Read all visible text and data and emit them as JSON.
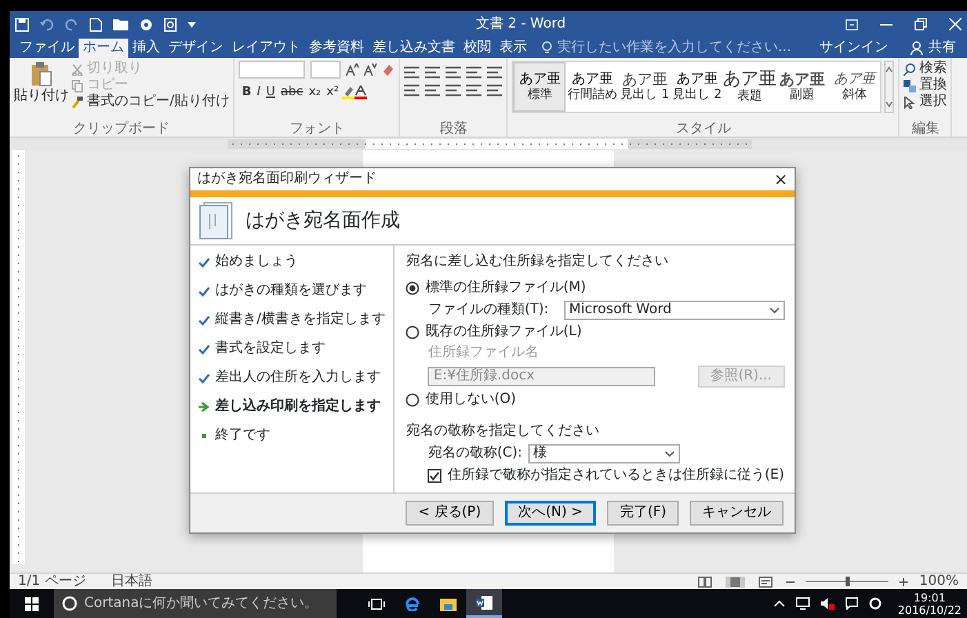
{
  "window": {
    "title": "文書 2 - Word"
  },
  "ribbon_tabs": [
    {
      "label": "ファイル",
      "selected": false
    },
    {
      "label": "ホーム",
      "selected": true
    },
    {
      "label": "挿入",
      "selected": false
    },
    {
      "label": "デザイン",
      "selected": false
    },
    {
      "label": "レイアウト",
      "selected": false
    },
    {
      "label": "参考資料",
      "selected": false
    },
    {
      "label": "差し込み文書",
      "selected": false
    },
    {
      "label": "校閲",
      "selected": false
    },
    {
      "label": "表示",
      "selected": false
    }
  ],
  "tell_me": {
    "placeholder": "実行したい作業を入力してください..."
  },
  "account": {
    "sign_in": "サインイン",
    "share": "共有"
  },
  "ribbon": {
    "clipboard": {
      "paste": "貼り付け",
      "items": [
        {
          "label": "切り取り",
          "disabled": true
        },
        {
          "label": "コピー",
          "disabled": true
        },
        {
          "label": "書式のコピー/貼り付け",
          "disabled": false
        }
      ],
      "label": "クリップボード"
    },
    "font": {
      "buttons": [
        "B",
        "I",
        "U",
        "abc",
        "x₂",
        "x²"
      ],
      "label": "フォント"
    },
    "paragraph": {
      "label": "段落"
    },
    "styles": {
      "items": [
        {
          "preview": "あア亜",
          "name": "標準",
          "kind": "normal",
          "selected": true
        },
        {
          "preview": "あア亜",
          "name": "行間詰め",
          "kind": "normal",
          "selected": false
        },
        {
          "preview": "あア亜",
          "name": "見出し 1",
          "kind": "heading",
          "selected": false
        },
        {
          "preview": "あア亜",
          "name": "見出し 2",
          "kind": "normal",
          "selected": false
        },
        {
          "preview": "あア亜",
          "name": "表題",
          "kind": "title",
          "selected": false
        },
        {
          "preview": "あア亜",
          "name": "副題",
          "kind": "subtitle",
          "selected": false
        },
        {
          "preview": "あア亜",
          "name": "斜体",
          "kind": "emphasis",
          "selected": false
        }
      ],
      "label": "スタイル"
    },
    "editing": {
      "find": "検索",
      "replace": "置換",
      "select": "選択",
      "label": "編集"
    }
  },
  "dialog": {
    "title": "はがき宛名面印刷ウィザード",
    "close": "×",
    "heading": "はがき宛名面作成",
    "steps": [
      {
        "label": "始めましょう",
        "kind": "done"
      },
      {
        "label": "はがきの種類を選びます",
        "kind": "done"
      },
      {
        "label": "縦書き/横書きを指定します",
        "kind": "done"
      },
      {
        "label": "書式を設定します",
        "kind": "done"
      },
      {
        "label": "差出人の住所を入力します",
        "kind": "done"
      },
      {
        "label": "差し込み印刷を指定します",
        "kind": "current"
      },
      {
        "label": "終了です",
        "kind": "pending"
      }
    ],
    "address_source": {
      "prompt": "宛名に差し込む住所録を指定してください",
      "options": [
        {
          "label": "標準の住所録ファイル(M)",
          "selected": true
        },
        {
          "label": "既存の住所録ファイル(L)",
          "selected": false
        },
        {
          "label": "使用しない(O)",
          "selected": false
        }
      ],
      "file_type": {
        "label": "ファイルの種類(T):",
        "value": "Microsoft Word"
      },
      "file_name": {
        "label": "住所録ファイル名",
        "value": "E:¥住所録.docx",
        "disabled": true
      },
      "browse_button": {
        "label": "参照(R)...",
        "disabled": true
      }
    },
    "honorific": {
      "prompt": "宛名の敬称を指定してください",
      "label": "宛名の敬称(C):",
      "value": "様",
      "follow_address_book": {
        "label": "住所録で敬称が指定されているときは住所録に従う(E)",
        "checked": true
      }
    },
    "buttons": [
      {
        "label": "< 戻る(P)",
        "default": false
      },
      {
        "label": "次へ(N) >",
        "default": true
      },
      {
        "label": "完了(F)",
        "default": false
      },
      {
        "label": "キャンセル",
        "default": false
      }
    ]
  },
  "status_bar": {
    "page": "1/1 ページ",
    "language": "日本語",
    "views": [
      {
        "selected": false
      },
      {
        "selected": true
      },
      {
        "selected": false
      }
    ],
    "zoom_slider": {
      "level": 0.5
    },
    "zoom": "100%"
  },
  "taskbar": {
    "search": {
      "placeholder": "Cortanaに何か聞いてみてください。"
    },
    "apps": [
      {
        "kind": "task-view",
        "selected": false
      },
      {
        "kind": "edge",
        "selected": false
      },
      {
        "kind": "explorer",
        "selected": false
      },
      {
        "kind": "word",
        "selected": true
      }
    ],
    "time": "19:01",
    "date": "2016/10/22"
  }
}
